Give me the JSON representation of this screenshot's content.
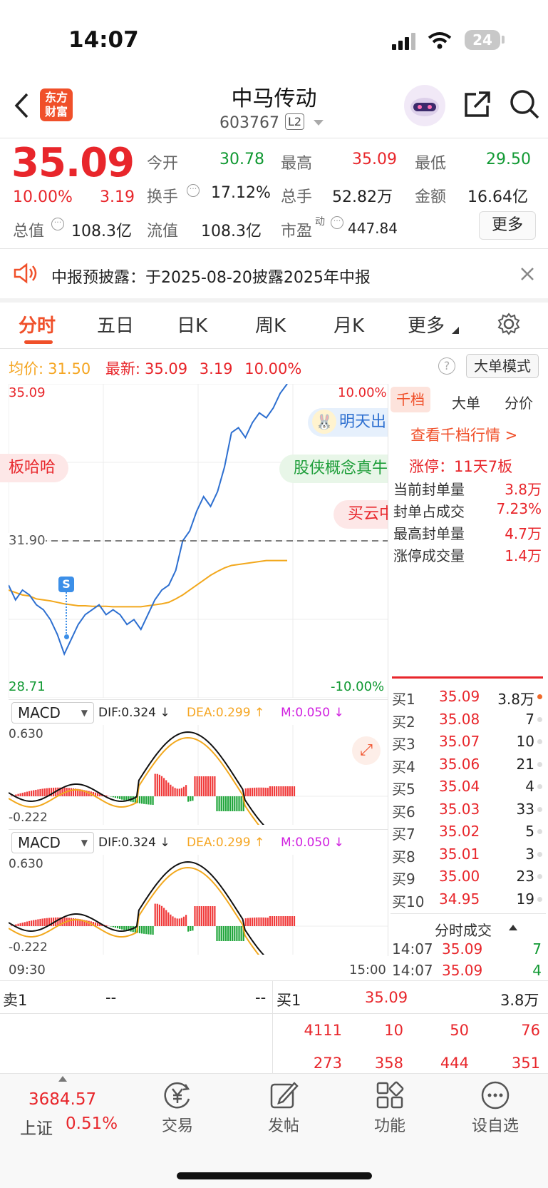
{
  "status": {
    "time": "14:07",
    "battery": "24"
  },
  "header": {
    "logo": "东方\n财富",
    "title": "中马传动",
    "code": "603767",
    "level": "L2"
  },
  "quote": {
    "price": "35.09",
    "pct": "10.00%",
    "chg": "3.19",
    "open_label": "今开",
    "open": "30.78",
    "high_label": "最高",
    "high": "35.09",
    "low_label": "最低",
    "low": "29.50",
    "turnover_label": "换手",
    "turnover": "17.12%",
    "volume_label": "总手",
    "volume": "52.82万",
    "amount_label": "金额",
    "amount": "16.64亿",
    "mcap_label": "总值",
    "mcap": "108.3亿",
    "float_label": "流值",
    "float": "108.3亿",
    "pe_label": "市盈",
    "pe_sup": "动",
    "pe": "447.84",
    "more": "更多"
  },
  "notice": "中报预披露：于2025-08-20披露2025年中报",
  "tabs": [
    "分时",
    "五日",
    "日K",
    "周K",
    "月K",
    "更多"
  ],
  "infobar": {
    "avg_label": "均价:",
    "avg": "31.50",
    "last_label": "最新:",
    "last": "35.09",
    "chg": "3.19",
    "pct": "10.00%",
    "mode": "大单模式"
  },
  "chart": {
    "ymax": "35.09",
    "ymin": "28.71",
    "pmax": "10.00%",
    "pmin": "-10.00%",
    "preclose": "31.90",
    "time_start": "09:30",
    "time_end": "15:00",
    "marker": "S",
    "bubbles": [
      "板哈哈",
      "明天出",
      "股侠概念真牛",
      "买云中"
    ]
  },
  "chart_data": {
    "type": "line",
    "series": [
      {
        "name": "价格",
        "color": "#2d6fd0",
        "values": [
          31.0,
          30.7,
          30.9,
          30.8,
          30.6,
          30.5,
          30.3,
          30.0,
          29.6,
          29.9,
          30.2,
          30.4,
          30.5,
          30.6,
          30.4,
          30.5,
          30.4,
          30.2,
          30.3,
          30.1,
          30.4,
          30.7,
          30.9,
          31.0,
          31.3,
          31.9,
          32.1,
          32.5,
          32.8,
          32.6,
          32.9,
          33.4,
          34.1,
          34.2,
          34.0,
          34.3,
          34.5,
          34.4,
          34.6,
          34.9,
          35.09
        ]
      },
      {
        "name": "均价",
        "color": "#f2a81d",
        "values": [
          30.9,
          30.85,
          30.8,
          30.78,
          30.72,
          30.7,
          30.68,
          30.65,
          30.62,
          30.6,
          30.58,
          30.58,
          30.57,
          30.57,
          30.57,
          30.56,
          30.56,
          30.56,
          30.56,
          30.56,
          30.58,
          30.6,
          30.62,
          30.65,
          30.72,
          30.8,
          30.9,
          31.0,
          31.1,
          31.2,
          31.28,
          31.35,
          31.4,
          31.42,
          31.44,
          31.46,
          31.48,
          31.5,
          31.5,
          31.5,
          31.5
        ]
      }
    ],
    "ylim": [
      28.71,
      35.09
    ]
  },
  "macd": {
    "label": "MACD",
    "dif": "DIF:0.324 ↓",
    "dea": "DEA:0.299 ↑",
    "m": "M:0.050 ↓",
    "top": "0.630",
    "bottom": "-0.222"
  },
  "rpanel": {
    "tabs": [
      "千档",
      "大单",
      "分价"
    ],
    "link": "查看千档行情 >",
    "limit": "涨停：11天7板",
    "rows": [
      {
        "k": "当前封单量",
        "v": "3.8万"
      },
      {
        "k": "封单占成交",
        "v": "7.23%"
      },
      {
        "k": "最高封单量",
        "v": "4.7万"
      },
      {
        "k": "涨停成交量",
        "v": "1.4万"
      }
    ]
  },
  "bids": [
    {
      "k": "买1",
      "p": "35.09",
      "v": "3.8万"
    },
    {
      "k": "买2",
      "p": "35.08",
      "v": "7"
    },
    {
      "k": "买3",
      "p": "35.07",
      "v": "10"
    },
    {
      "k": "买4",
      "p": "35.06",
      "v": "21"
    },
    {
      "k": "买5",
      "p": "35.04",
      "v": "4"
    },
    {
      "k": "买6",
      "p": "35.03",
      "v": "33"
    },
    {
      "k": "买7",
      "p": "35.02",
      "v": "5"
    },
    {
      "k": "买8",
      "p": "35.01",
      "v": "3"
    },
    {
      "k": "买9",
      "p": "35.00",
      "v": "23"
    },
    {
      "k": "买10",
      "p": "34.95",
      "v": "19"
    }
  ],
  "ticks_title": "分时成交",
  "ticks": [
    {
      "t": "14:07",
      "p": "35.09",
      "v": "7"
    },
    {
      "t": "14:07",
      "p": "35.09",
      "v": "4"
    }
  ],
  "book": {
    "sell_label": "卖1",
    "sell_p": "--",
    "sell_v": "--",
    "buy_label": "买1",
    "buy_p": "35.09",
    "buy_v": "3.8万",
    "row1": [
      "4111",
      "10",
      "50",
      "76"
    ],
    "row2": [
      "273",
      "358",
      "444",
      "351"
    ]
  },
  "bottom": {
    "index_val": "3684.57",
    "index_name": "上证",
    "index_pct": "0.51%",
    "items": [
      "交易",
      "发帖",
      "功能",
      "设自选"
    ]
  }
}
